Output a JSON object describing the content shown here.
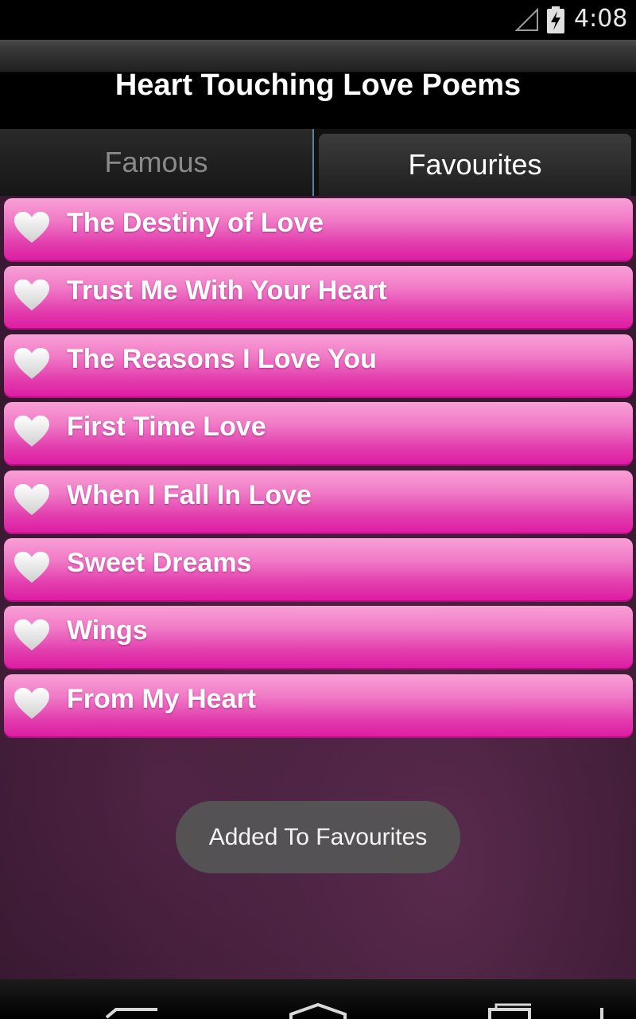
{
  "status_bar": {
    "time": "4:08"
  },
  "app": {
    "title": "Heart Touching Love Poems"
  },
  "tabs": [
    {
      "label": "Famous",
      "selected": false
    },
    {
      "label": "Favourites",
      "selected": true
    }
  ],
  "poems": [
    {
      "title": "The Destiny of Love"
    },
    {
      "title": "Trust Me With Your Heart"
    },
    {
      "title": "The Reasons I Love You"
    },
    {
      "title": "First Time Love"
    },
    {
      "title": "When I Fall In Love"
    },
    {
      "title": "Sweet Dreams"
    },
    {
      "title": "Wings"
    },
    {
      "title": "From My Heart"
    }
  ],
  "toast": {
    "message": "Added To Favourites"
  },
  "colors": {
    "item_top": "#f9a0d6",
    "item_bottom": "#dd1aa2",
    "background": "#3a1a33"
  }
}
